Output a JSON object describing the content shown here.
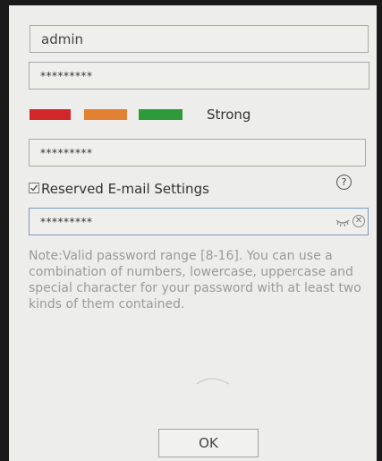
{
  "form": {
    "username_value": "admin",
    "password_value": "*********",
    "strength": {
      "label": "Strong",
      "level_colors": [
        "#d3262b",
        "#e38132",
        "#2f9a3a"
      ]
    },
    "confirm_password_value": "*********",
    "reserved_email": {
      "label": "Reserved E-mail Settings",
      "checked": true,
      "help_icon": "question-circle-icon"
    },
    "email_password_value": "*********",
    "email_icons": [
      "eye-closed-icon",
      "clear-icon"
    ],
    "note": "Note:Valid password range [8-16]. You can use a combination of numbers, lowercase, uppercase and special character for your password with at least two kinds of them contained.",
    "ok_label": "OK"
  }
}
